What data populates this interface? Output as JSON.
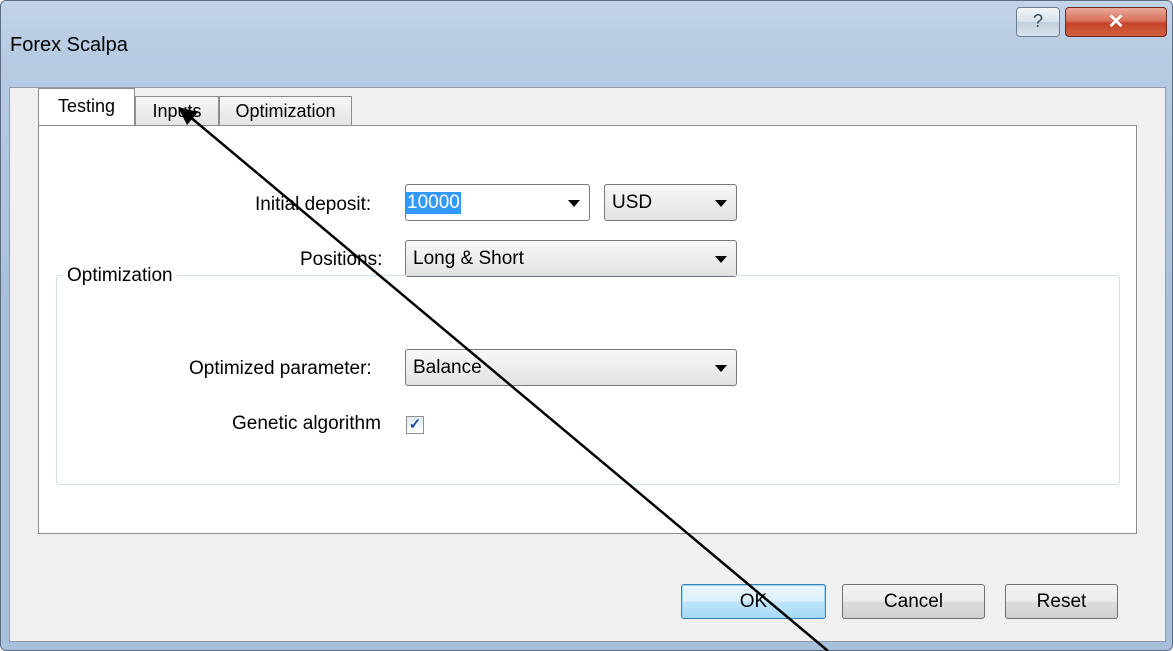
{
  "window": {
    "title": "Forex Scalpa",
    "help_glyph": "?",
    "close_glyph": "✕"
  },
  "tabs": [
    {
      "label": "Testing",
      "active": true
    },
    {
      "label": "Inputs",
      "active": false
    },
    {
      "label": "Optimization",
      "active": false
    }
  ],
  "testing": {
    "initial_deposit_label": "Initial deposit:",
    "initial_deposit_value": "10000",
    "currency_value": "USD",
    "positions_label": "Positions:",
    "positions_value": "Long & Short",
    "optimization_group_title": "Optimization",
    "optimized_parameter_label": "Optimized parameter:",
    "optimized_parameter_value": "Balance",
    "genetic_algorithm_label": "Genetic algorithm",
    "genetic_algorithm_checked": true,
    "check_glyph": "✓"
  },
  "buttons": {
    "ok": "OK",
    "cancel": "Cancel",
    "reset": "Reset"
  },
  "colors": {
    "selection": "#3399ff",
    "close_button": "#c5432a",
    "title_bar": "#b7cbe3"
  }
}
